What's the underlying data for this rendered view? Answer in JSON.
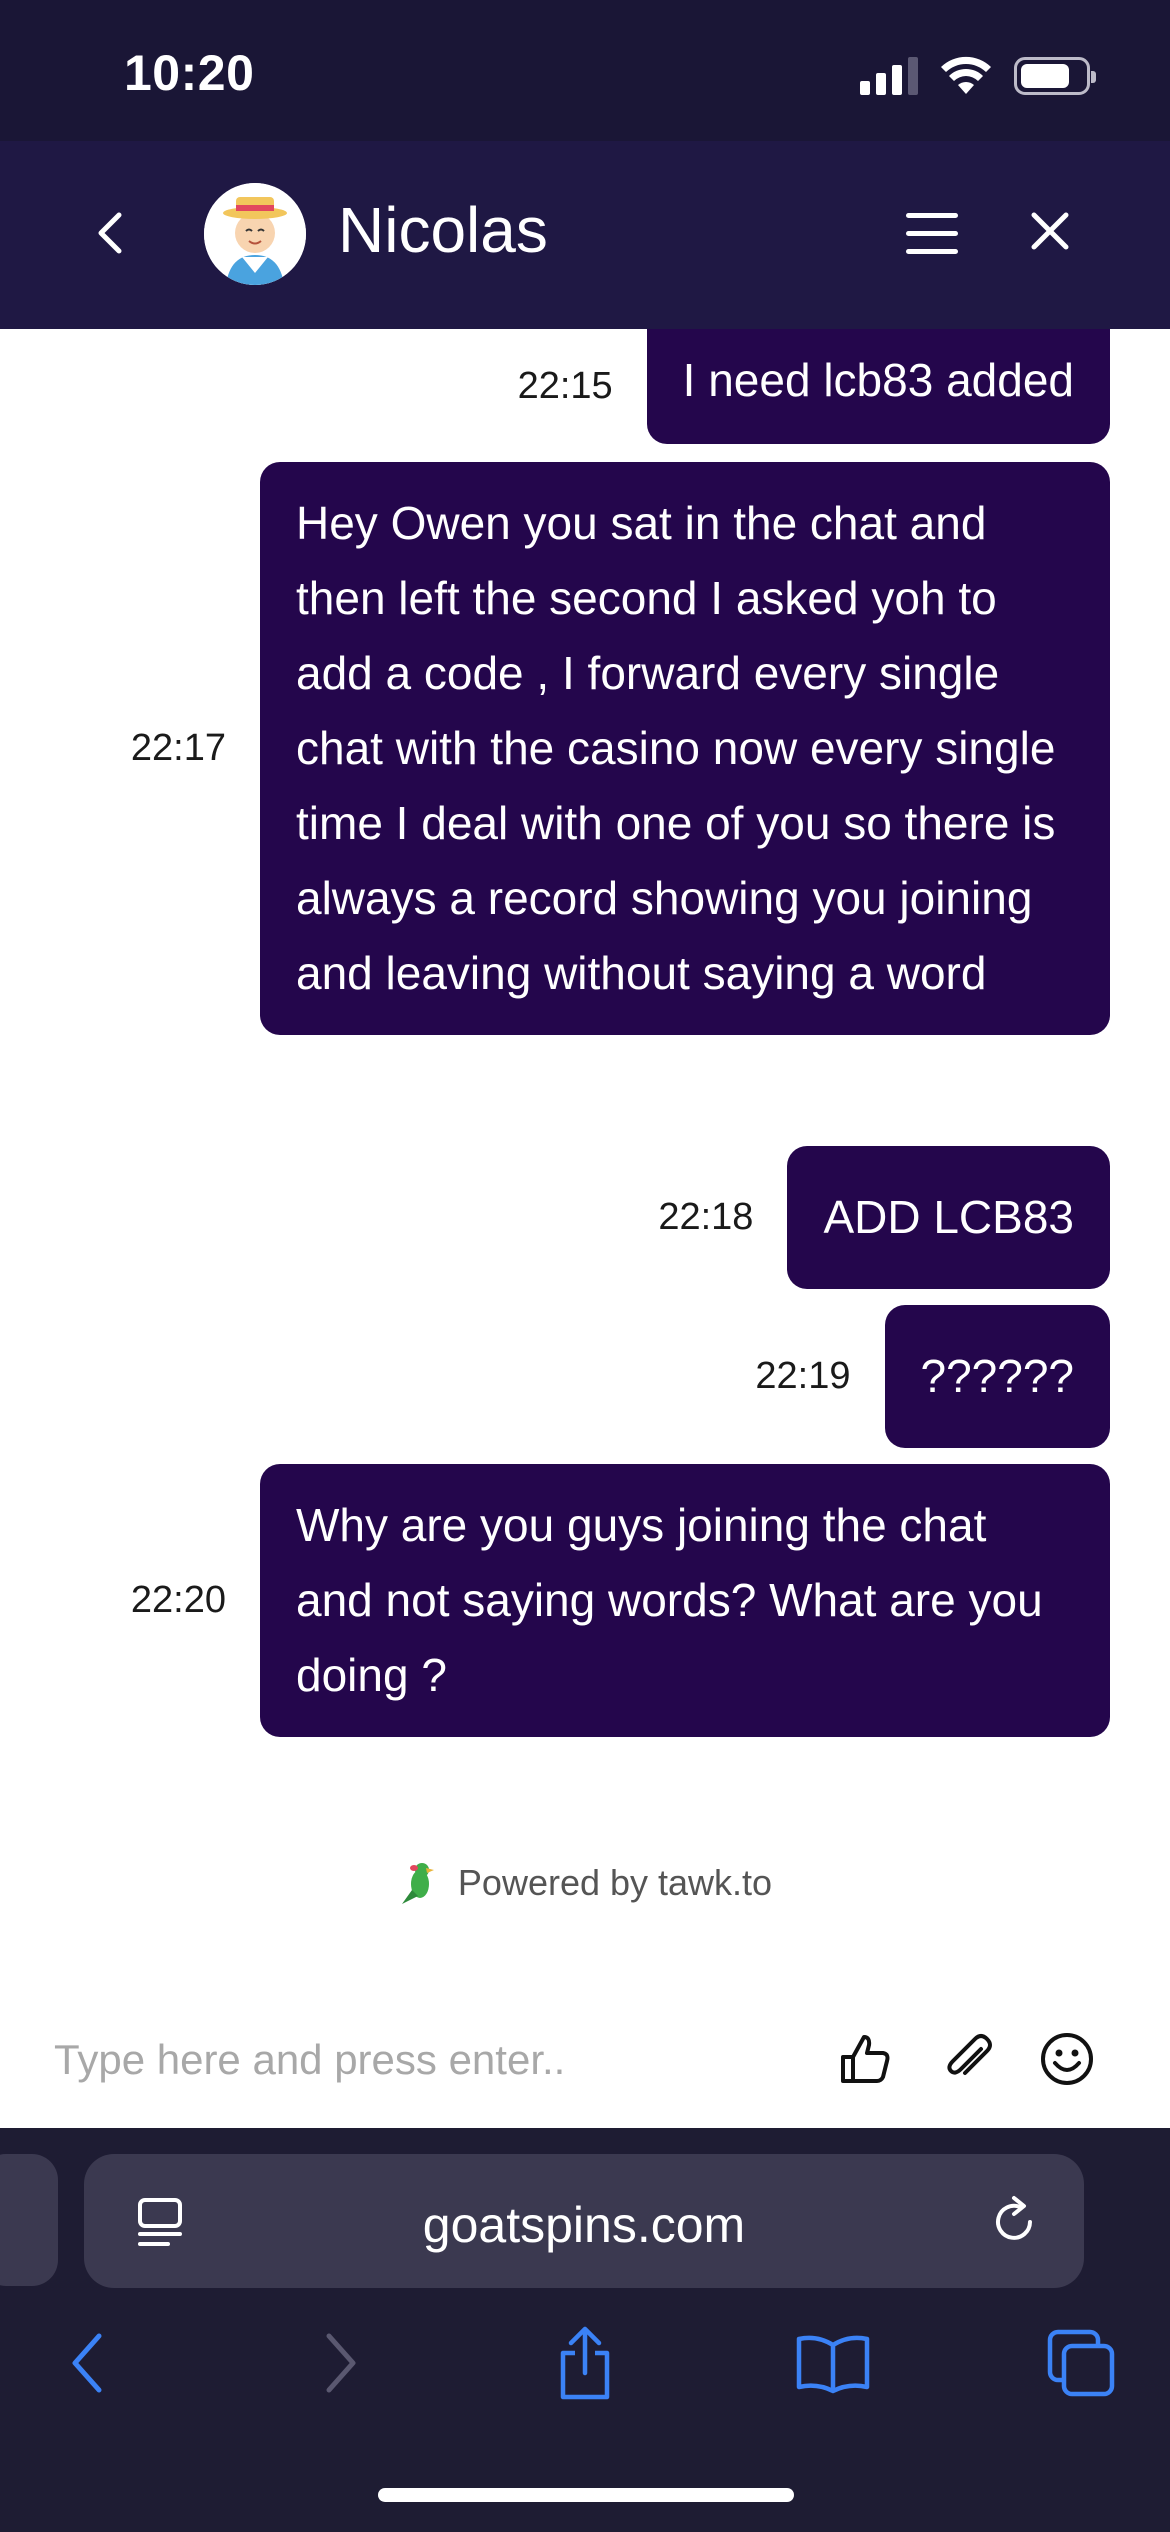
{
  "status_bar": {
    "time": "10:20",
    "icons": [
      "cellular-signal-icon",
      "wifi-icon",
      "battery-icon"
    ]
  },
  "header": {
    "agent_name": "Nicolas",
    "icons": [
      "back-chevron-icon",
      "avatar",
      "menu-icon",
      "close-icon"
    ]
  },
  "messages": [
    {
      "time": "22:15",
      "text": "I need lcb83 added"
    },
    {
      "time": "22:17",
      "text": "Hey Owen you sat in the chat and then left the second I asked yoh to add a code , I forward every single chat with the casino now every single time I deal with one of you so there is always a record showing you joining and leaving without saying a word"
    },
    {
      "time": "22:18",
      "text": "ADD LCB83"
    },
    {
      "time": "22:19",
      "text": "??????"
    },
    {
      "time": "22:20",
      "text": "Why are you guys joining the chat and not saying words? What are you doing ?"
    }
  ],
  "powered_by": "Powered by tawk.to",
  "composer": {
    "placeholder": "Type here and press enter..",
    "icons": [
      "thumbs-up-icon",
      "paperclip-icon",
      "emoji-icon"
    ]
  },
  "browser": {
    "url": "goatspins.com",
    "toolbar_icons": [
      "back-icon",
      "forward-icon",
      "share-icon",
      "bookmarks-icon",
      "tabs-icon"
    ]
  },
  "colors": {
    "status_bar_bg": "#1a1636",
    "header_bg": "#1f1844",
    "bubble_bg": "#24064c",
    "safari_bg": "#1e1c33",
    "safari_accent": "#3b82f6"
  }
}
